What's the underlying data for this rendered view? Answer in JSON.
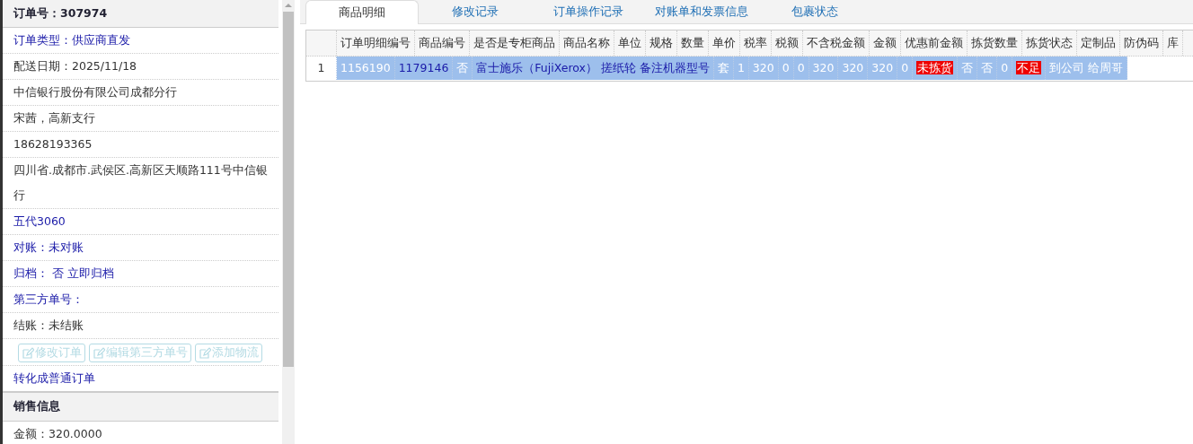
{
  "order_panel": {
    "title": "订单号：307974",
    "rows": [
      {
        "kind": "link",
        "text": "订单类型：供应商直发"
      },
      {
        "kind": "text",
        "text": "配送日期：2025/11/18"
      },
      {
        "kind": "text",
        "text": "中信银行股份有限公司成都分行"
      },
      {
        "kind": "text",
        "text": "宋茜，高新支行"
      },
      {
        "kind": "text",
        "text": "18628193365"
      },
      {
        "kind": "text",
        "text": "四川省.成都市.武侯区.高新区天顺路111号中信银行"
      },
      {
        "kind": "link",
        "text": "五代3060"
      },
      {
        "kind": "link",
        "text": "对账：未对账"
      },
      {
        "kind": "link",
        "text": "归档：  否 立即归档"
      },
      {
        "kind": "link",
        "text": "第三方单号："
      },
      {
        "kind": "text",
        "text": "结账：未结账"
      }
    ],
    "buttons": [
      {
        "label": "修改订单",
        "disabled": true
      },
      {
        "label": "编辑第三方单号",
        "disabled": true
      },
      {
        "label": "添加物流",
        "disabled": true
      }
    ],
    "convert_link": "转化成普通订单",
    "sales_title": "销售信息",
    "sales_rows": [
      {
        "kind": "text",
        "text": "金额：320.0000"
      }
    ]
  },
  "tabs": [
    {
      "label": "商品明细",
      "selected": true
    },
    {
      "label": "修改记录",
      "selected": false
    },
    {
      "label": "订单操作记录",
      "selected": false
    },
    {
      "label": "对账单和发票信息",
      "selected": false
    },
    {
      "label": "包裹状态",
      "selected": false
    }
  ],
  "goods_list": {
    "header_labels": [
      "订单明细编号",
      "商品编号",
      "是否是专柜商品",
      "商品名称",
      "单位",
      "规格",
      "数量",
      "单价",
      "税率",
      "税额",
      "不含税金额",
      "金额",
      "优惠前金额",
      "拣货数量",
      "拣货状态",
      "定制品",
      "防伪码",
      "库"
    ],
    "entries": [
      {
        "number": "1",
        "selected": true,
        "values": [
          {
            "kind": "text",
            "text": "1156190"
          },
          {
            "kind": "link",
            "text": "1179146"
          },
          {
            "kind": "text",
            "text": "否"
          },
          {
            "kind": "link",
            "text": "富士施乐（FujiXerox） 搓纸轮 备注机器型号"
          },
          {
            "kind": "text",
            "text": "套"
          },
          {
            "kind": "text",
            "text": "1"
          },
          {
            "kind": "text",
            "text": "320"
          },
          {
            "kind": "text",
            "text": "0"
          },
          {
            "kind": "text",
            "text": "0"
          },
          {
            "kind": "text",
            "text": "320"
          },
          {
            "kind": "text",
            "text": "320"
          },
          {
            "kind": "text",
            "text": "320"
          },
          {
            "kind": "text",
            "text": "0"
          },
          {
            "kind": "alert",
            "text": "未拣货"
          },
          {
            "kind": "text",
            "text": "否"
          },
          {
            "kind": "text",
            "text": "否"
          },
          {
            "kind": "text",
            "text": "0"
          },
          {
            "kind": "alert",
            "text": "不足"
          },
          {
            "kind": "text",
            "text": "到公司 给周哥"
          }
        ]
      }
    ]
  }
}
